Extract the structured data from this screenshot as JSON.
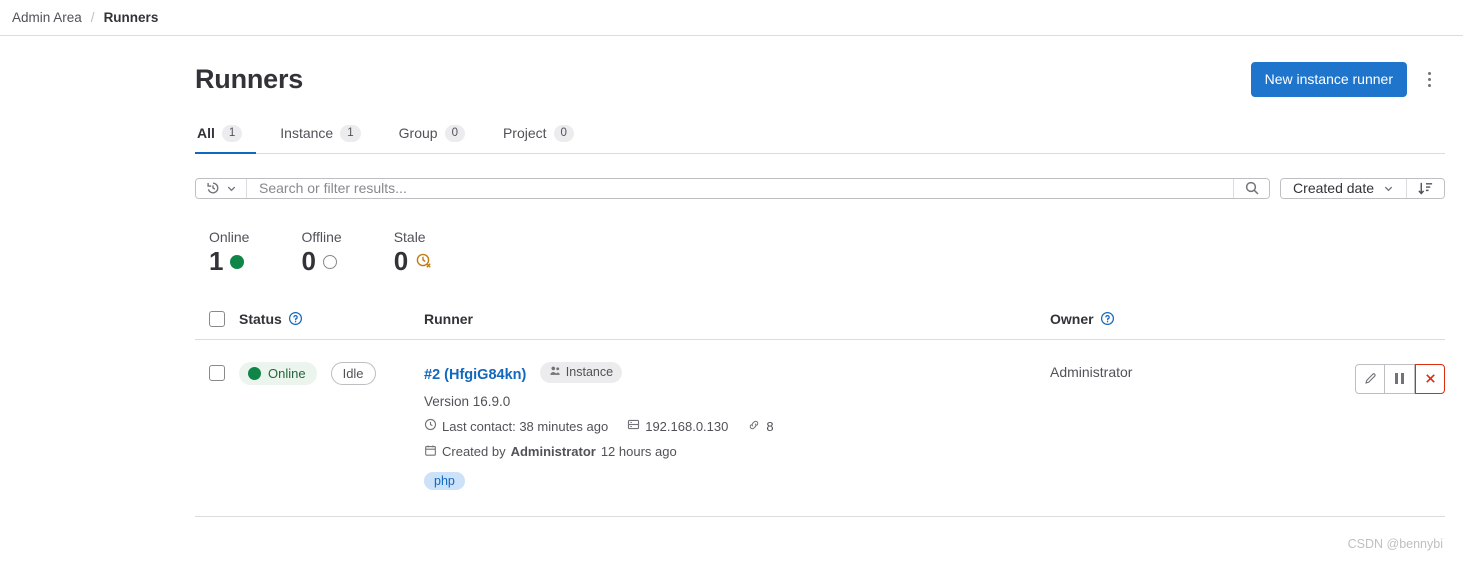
{
  "breadcrumb": {
    "root": "Admin Area",
    "separator": "/",
    "current": "Runners"
  },
  "header": {
    "title": "Runners",
    "primary_button": "New instance runner",
    "kebab_icon": "ellipsis-vertical-icon"
  },
  "tabs": [
    {
      "label": "All",
      "count": "1",
      "active": true
    },
    {
      "label": "Instance",
      "count": "1",
      "active": false
    },
    {
      "label": "Group",
      "count": "0",
      "active": false
    },
    {
      "label": "Project",
      "count": "0",
      "active": false
    }
  ],
  "filters": {
    "history_icon": "history-icon",
    "chevron_icon": "chevron-down-icon",
    "search_placeholder": "Search or filter results...",
    "search_value": "",
    "search_icon": "search-icon",
    "sort_field": "Created date",
    "sort_direction_icon": "sort-descending-icon"
  },
  "stats": [
    {
      "label": "Online",
      "value": "1",
      "icon": "status-online-dot",
      "color": "#108548"
    },
    {
      "label": "Offline",
      "value": "0",
      "icon": "status-offline-circle",
      "color": "#89888d"
    },
    {
      "label": "Stale",
      "value": "0",
      "icon": "clock-x-icon",
      "color": "#c17d10"
    }
  ],
  "table": {
    "columns": {
      "status": "Status",
      "runner": "Runner",
      "owner": "Owner"
    },
    "help_icon": "question-circle-icon",
    "select_all_checkbox": "checkbox-unchecked"
  },
  "rows": [
    {
      "checkbox": "checkbox-unchecked",
      "status_badge": "Online",
      "idle_badge": "Idle",
      "name": "#2 (HfgiG84kn)",
      "type_badge": "Instance",
      "type_badge_icon": "users-icon",
      "version": "Version 16.9.0",
      "last_contact_icon": "clock-icon",
      "last_contact": "Last contact: 38 minutes ago",
      "ip_icon": "server-icon",
      "ip_address": "192.168.0.130",
      "jobs_icon": "link-icon",
      "jobs_count": "8",
      "created_icon": "calendar-icon",
      "created_prefix": "Created by",
      "created_by": "Administrator",
      "created_suffix": "12 hours ago",
      "tags": [
        "php"
      ],
      "owner": "Administrator",
      "actions": {
        "edit_icon": "pencil-icon",
        "pause_icon": "pause-icon",
        "delete_icon": "close-x-icon"
      }
    }
  ],
  "watermark": "CSDN @bennybi"
}
